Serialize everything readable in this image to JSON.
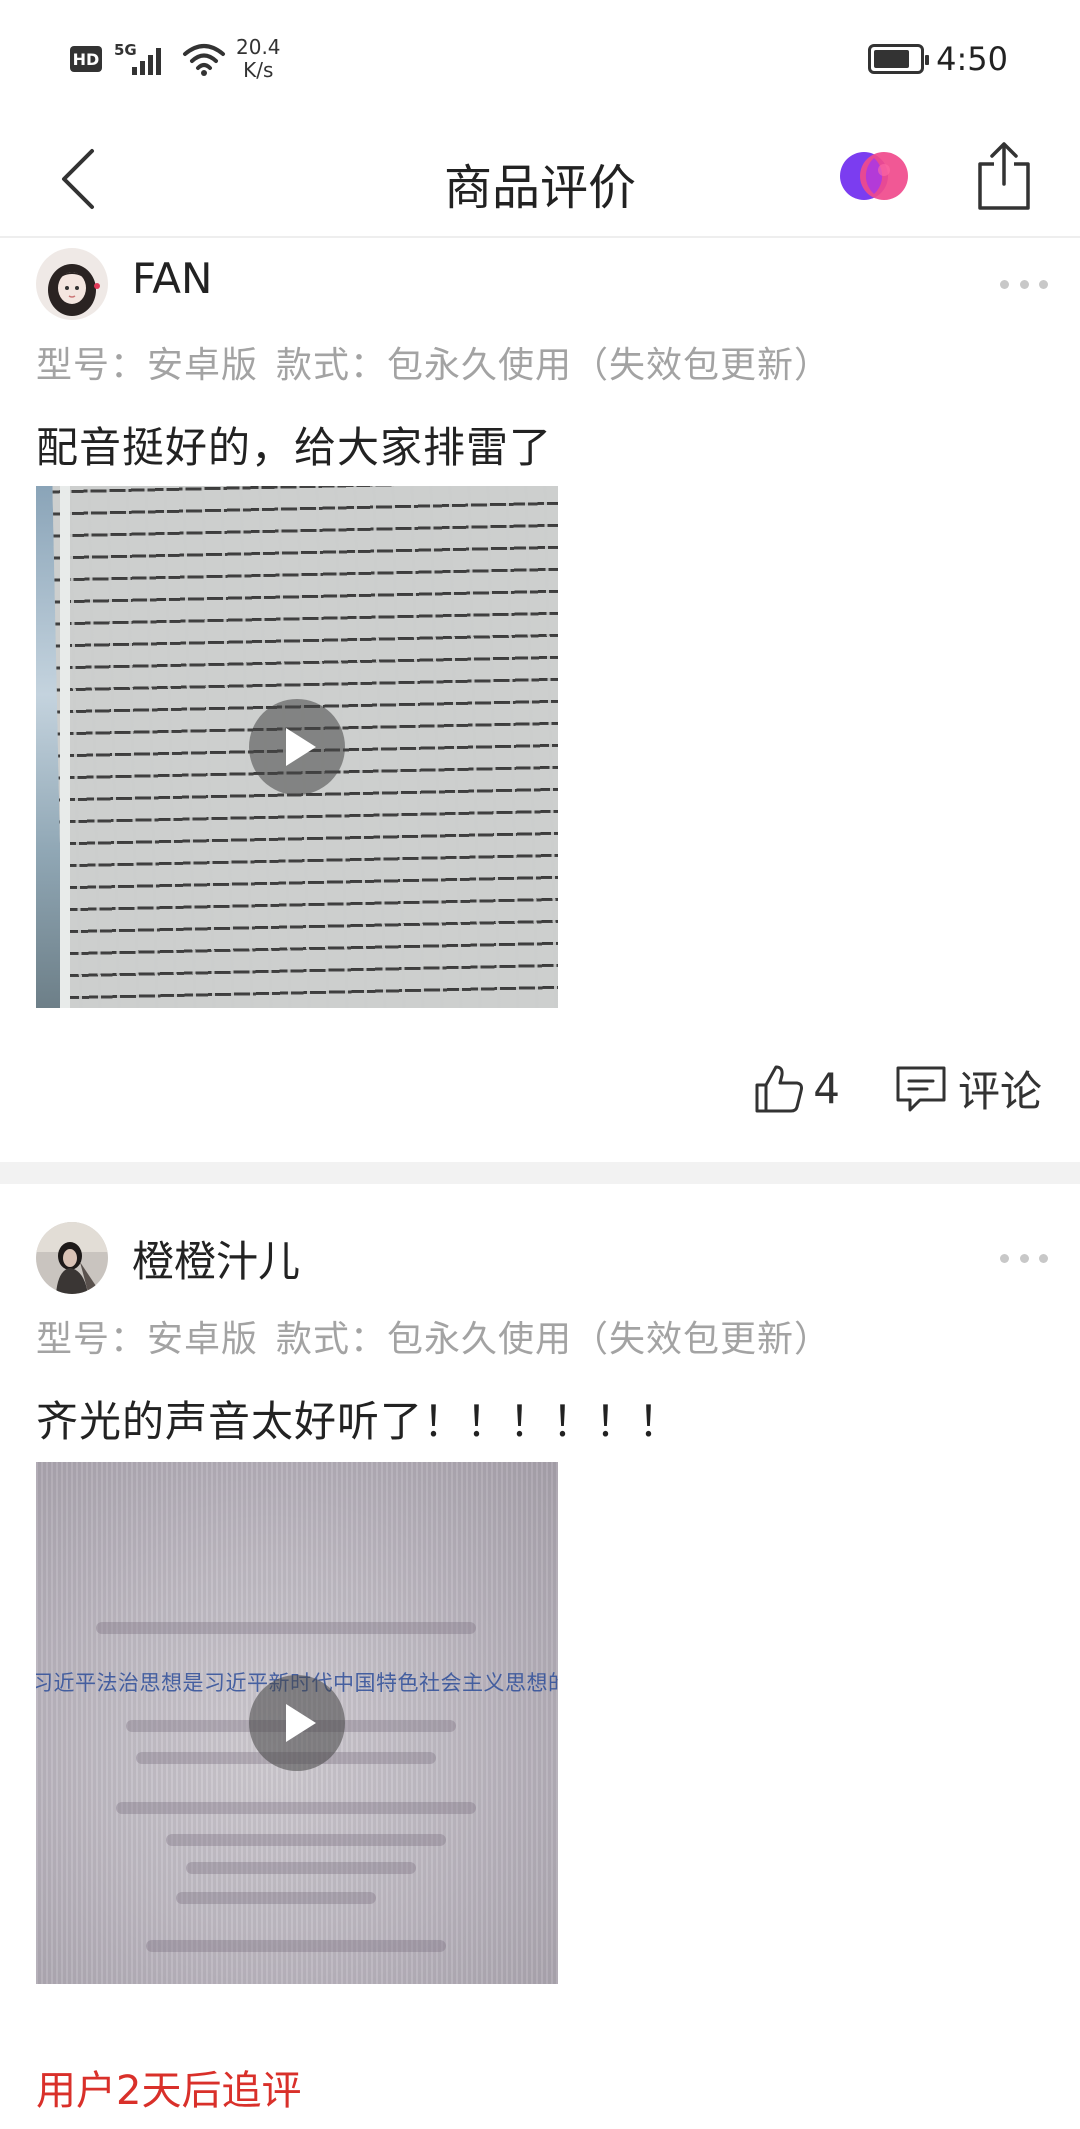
{
  "status_bar": {
    "hd": "HD",
    "network": "5G",
    "speed_value": "20.4",
    "speed_unit": "K/s",
    "battery_level": 0.8,
    "time": "4:50"
  },
  "header": {
    "title": "商品评价",
    "back_icon": "chevron-left-icon",
    "logo_icon": "brand-logo-icon",
    "share_icon": "share-icon"
  },
  "colors": {
    "accent_red": "#d9302a",
    "spec_gray": "#a3a3a3",
    "divider": "#f2f2f2"
  },
  "reviews": [
    {
      "username": "FAN",
      "specs_model": "型号：安卓版",
      "specs_style": "款式：包永久使用（失效包更新）",
      "text": "配音挺好的，给大家排雷了",
      "media": "video",
      "likes": "4",
      "comment_label": "评论"
    },
    {
      "username": "橙橙汁儿",
      "specs_model": "型号：安卓版",
      "specs_style": "款式：包永久使用（失效包更新）",
      "text": "齐光的声音太好听了！！！！！！",
      "media": "video",
      "video_caption": "习近平法治思想是习近平新时代中国特色社会主义思想的重要组",
      "followup": "用户2天后追评"
    }
  ]
}
